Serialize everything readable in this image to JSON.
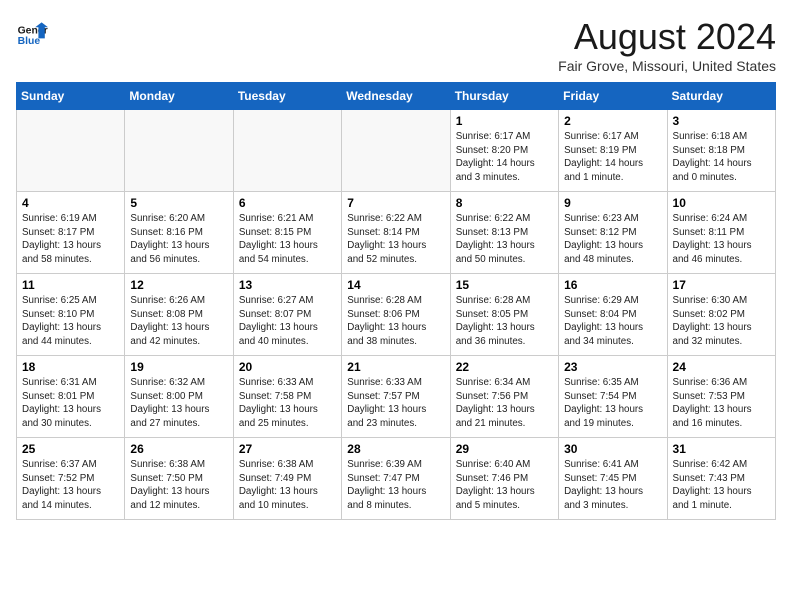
{
  "logo": {
    "general": "General",
    "blue": "Blue"
  },
  "header": {
    "month_year": "August 2024",
    "location": "Fair Grove, Missouri, United States"
  },
  "days_of_week": [
    "Sunday",
    "Monday",
    "Tuesday",
    "Wednesday",
    "Thursday",
    "Friday",
    "Saturday"
  ],
  "weeks": [
    [
      {
        "day": "",
        "empty": true
      },
      {
        "day": "",
        "empty": true
      },
      {
        "day": "",
        "empty": true
      },
      {
        "day": "",
        "empty": true
      },
      {
        "day": "1",
        "lines": [
          "Sunrise: 6:17 AM",
          "Sunset: 8:20 PM",
          "Daylight: 14 hours",
          "and 3 minutes."
        ]
      },
      {
        "day": "2",
        "lines": [
          "Sunrise: 6:17 AM",
          "Sunset: 8:19 PM",
          "Daylight: 14 hours",
          "and 1 minute."
        ]
      },
      {
        "day": "3",
        "lines": [
          "Sunrise: 6:18 AM",
          "Sunset: 8:18 PM",
          "Daylight: 14 hours",
          "and 0 minutes."
        ]
      }
    ],
    [
      {
        "day": "4",
        "lines": [
          "Sunrise: 6:19 AM",
          "Sunset: 8:17 PM",
          "Daylight: 13 hours",
          "and 58 minutes."
        ]
      },
      {
        "day": "5",
        "lines": [
          "Sunrise: 6:20 AM",
          "Sunset: 8:16 PM",
          "Daylight: 13 hours",
          "and 56 minutes."
        ]
      },
      {
        "day": "6",
        "lines": [
          "Sunrise: 6:21 AM",
          "Sunset: 8:15 PM",
          "Daylight: 13 hours",
          "and 54 minutes."
        ]
      },
      {
        "day": "7",
        "lines": [
          "Sunrise: 6:22 AM",
          "Sunset: 8:14 PM",
          "Daylight: 13 hours",
          "and 52 minutes."
        ]
      },
      {
        "day": "8",
        "lines": [
          "Sunrise: 6:22 AM",
          "Sunset: 8:13 PM",
          "Daylight: 13 hours",
          "and 50 minutes."
        ]
      },
      {
        "day": "9",
        "lines": [
          "Sunrise: 6:23 AM",
          "Sunset: 8:12 PM",
          "Daylight: 13 hours",
          "and 48 minutes."
        ]
      },
      {
        "day": "10",
        "lines": [
          "Sunrise: 6:24 AM",
          "Sunset: 8:11 PM",
          "Daylight: 13 hours",
          "and 46 minutes."
        ]
      }
    ],
    [
      {
        "day": "11",
        "lines": [
          "Sunrise: 6:25 AM",
          "Sunset: 8:10 PM",
          "Daylight: 13 hours",
          "and 44 minutes."
        ]
      },
      {
        "day": "12",
        "lines": [
          "Sunrise: 6:26 AM",
          "Sunset: 8:08 PM",
          "Daylight: 13 hours",
          "and 42 minutes."
        ]
      },
      {
        "day": "13",
        "lines": [
          "Sunrise: 6:27 AM",
          "Sunset: 8:07 PM",
          "Daylight: 13 hours",
          "and 40 minutes."
        ]
      },
      {
        "day": "14",
        "lines": [
          "Sunrise: 6:28 AM",
          "Sunset: 8:06 PM",
          "Daylight: 13 hours",
          "and 38 minutes."
        ]
      },
      {
        "day": "15",
        "lines": [
          "Sunrise: 6:28 AM",
          "Sunset: 8:05 PM",
          "Daylight: 13 hours",
          "and 36 minutes."
        ]
      },
      {
        "day": "16",
        "lines": [
          "Sunrise: 6:29 AM",
          "Sunset: 8:04 PM",
          "Daylight: 13 hours",
          "and 34 minutes."
        ]
      },
      {
        "day": "17",
        "lines": [
          "Sunrise: 6:30 AM",
          "Sunset: 8:02 PM",
          "Daylight: 13 hours",
          "and 32 minutes."
        ]
      }
    ],
    [
      {
        "day": "18",
        "lines": [
          "Sunrise: 6:31 AM",
          "Sunset: 8:01 PM",
          "Daylight: 13 hours",
          "and 30 minutes."
        ]
      },
      {
        "day": "19",
        "lines": [
          "Sunrise: 6:32 AM",
          "Sunset: 8:00 PM",
          "Daylight: 13 hours",
          "and 27 minutes."
        ]
      },
      {
        "day": "20",
        "lines": [
          "Sunrise: 6:33 AM",
          "Sunset: 7:58 PM",
          "Daylight: 13 hours",
          "and 25 minutes."
        ]
      },
      {
        "day": "21",
        "lines": [
          "Sunrise: 6:33 AM",
          "Sunset: 7:57 PM",
          "Daylight: 13 hours",
          "and 23 minutes."
        ]
      },
      {
        "day": "22",
        "lines": [
          "Sunrise: 6:34 AM",
          "Sunset: 7:56 PM",
          "Daylight: 13 hours",
          "and 21 minutes."
        ]
      },
      {
        "day": "23",
        "lines": [
          "Sunrise: 6:35 AM",
          "Sunset: 7:54 PM",
          "Daylight: 13 hours",
          "and 19 minutes."
        ]
      },
      {
        "day": "24",
        "lines": [
          "Sunrise: 6:36 AM",
          "Sunset: 7:53 PM",
          "Daylight: 13 hours",
          "and 16 minutes."
        ]
      }
    ],
    [
      {
        "day": "25",
        "lines": [
          "Sunrise: 6:37 AM",
          "Sunset: 7:52 PM",
          "Daylight: 13 hours",
          "and 14 minutes."
        ]
      },
      {
        "day": "26",
        "lines": [
          "Sunrise: 6:38 AM",
          "Sunset: 7:50 PM",
          "Daylight: 13 hours",
          "and 12 minutes."
        ]
      },
      {
        "day": "27",
        "lines": [
          "Sunrise: 6:38 AM",
          "Sunset: 7:49 PM",
          "Daylight: 13 hours",
          "and 10 minutes."
        ]
      },
      {
        "day": "28",
        "lines": [
          "Sunrise: 6:39 AM",
          "Sunset: 7:47 PM",
          "Daylight: 13 hours",
          "and 8 minutes."
        ]
      },
      {
        "day": "29",
        "lines": [
          "Sunrise: 6:40 AM",
          "Sunset: 7:46 PM",
          "Daylight: 13 hours",
          "and 5 minutes."
        ]
      },
      {
        "day": "30",
        "lines": [
          "Sunrise: 6:41 AM",
          "Sunset: 7:45 PM",
          "Daylight: 13 hours",
          "and 3 minutes."
        ]
      },
      {
        "day": "31",
        "lines": [
          "Sunrise: 6:42 AM",
          "Sunset: 7:43 PM",
          "Daylight: 13 hours",
          "and 1 minute."
        ]
      }
    ]
  ]
}
